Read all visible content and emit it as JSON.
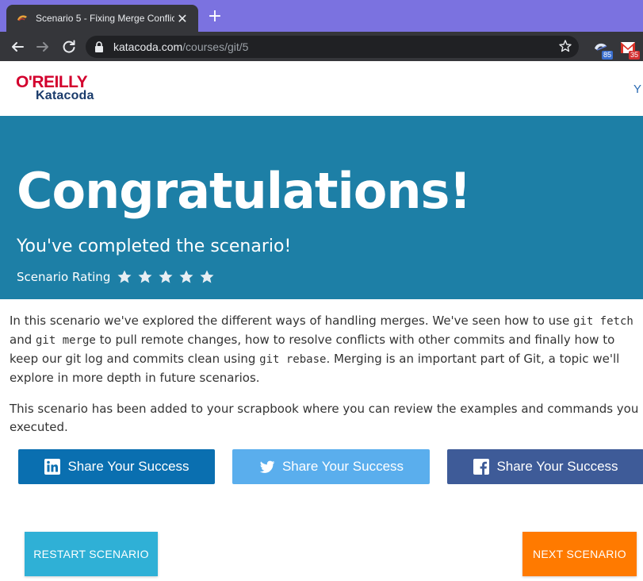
{
  "browser": {
    "tab": {
      "title": "Scenario 5 - Fixing Merge Conflic",
      "close_label": "✕",
      "favicon": "katacoda-favicon"
    },
    "new_tab_label": "+",
    "url_host": "katacoda.com",
    "url_path": "/courses/git/5",
    "extensions": [
      {
        "name": "extension-a",
        "badge": "85",
        "badge_color": "#3a6fcf"
      },
      {
        "name": "gmail-extension",
        "badge": "35",
        "badge_color": "#d32f2f"
      }
    ]
  },
  "header": {
    "logo_top": "O'REILLY",
    "logo_bottom": "Katacoda",
    "link_partial": "Y"
  },
  "hero": {
    "title": "Congratulations!",
    "subtitle": "You've completed the scenario!",
    "rating_label": "Scenario Rating",
    "stars": 5
  },
  "content": {
    "p1": {
      "t1": "In this scenario we've explored the different ways of handling merges. We've seen how to use ",
      "c1": "git fetch",
      "t2": " and ",
      "c2": "git merge",
      "t3": " to pull remote changes, how to resolve conflicts with other commits and finally how to keep our git log and commits clean using ",
      "c3": "git rebase",
      "t4": ". Merging is an important part of Git, a topic we'll explore in more depth in future scenarios."
    },
    "p2": "This scenario has been added to your scrapbook where you can review the examples and commands you executed."
  },
  "share": {
    "linkedin_label": "Share Your Success",
    "twitter_label": "Share Your Success",
    "facebook_label": "Share Your Success"
  },
  "actions": {
    "restart_label": "RESTART SCENARIO",
    "next_label": "NEXT SCENARIO"
  },
  "colors": {
    "hero_bg": "#1d7fa6",
    "linkedin": "#0a6fb0",
    "twitter": "#5aaeed",
    "facebook": "#3e5b98",
    "restart": "#2fb0d6",
    "next": "#ff7a00",
    "tabstrip": "#7b72e0"
  }
}
